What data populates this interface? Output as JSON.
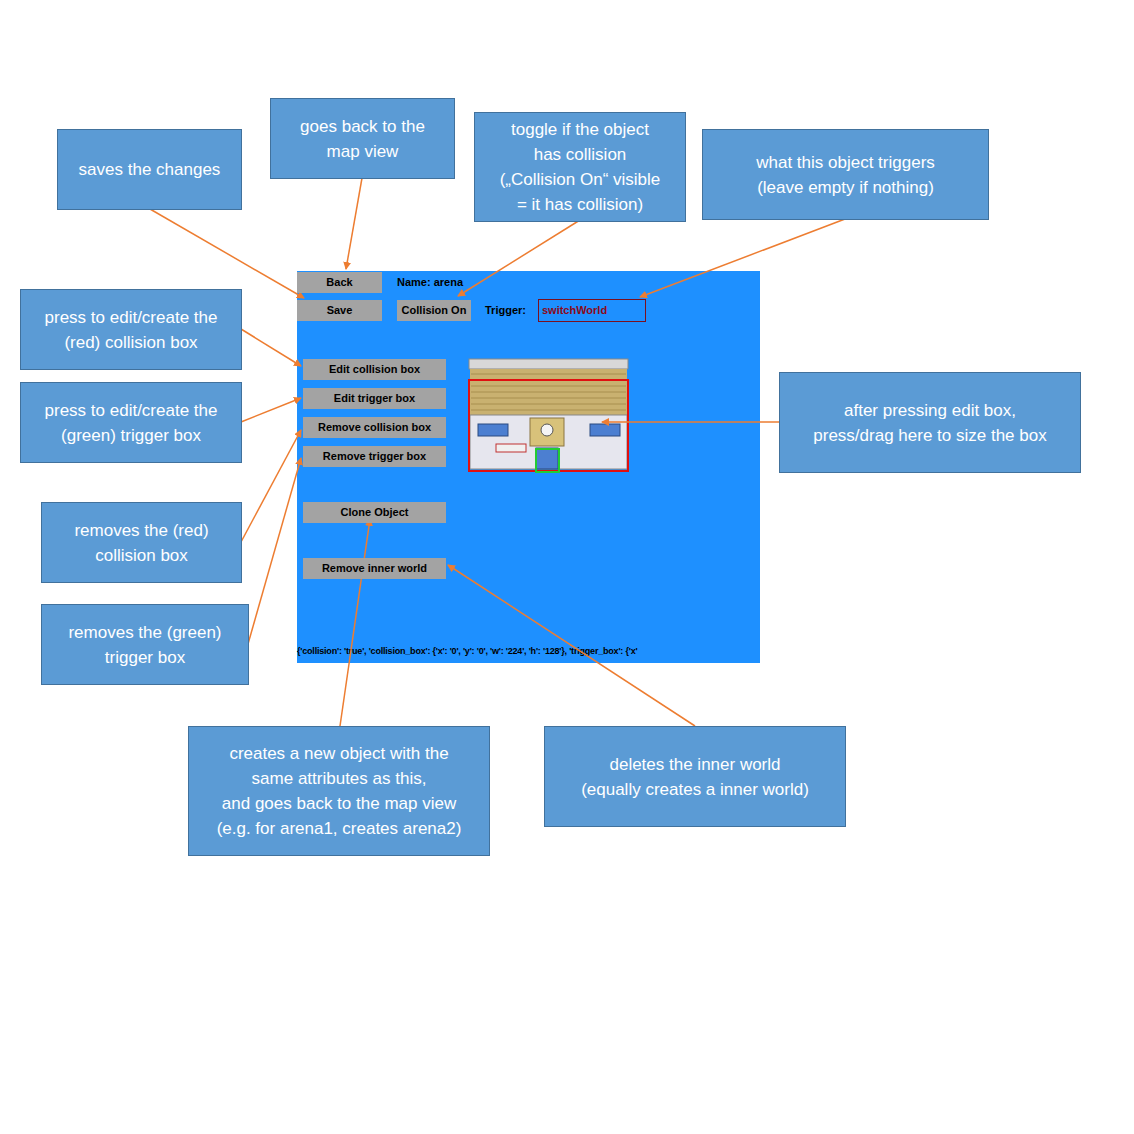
{
  "annotations": [
    {
      "lines": [
        "saves the changes"
      ]
    },
    {
      "lines": [
        "goes back to the",
        "map view"
      ]
    },
    {
      "lines": [
        "toggle if the object",
        "has collision",
        "(„Collision On“ visible",
        "= it has collision)"
      ]
    },
    {
      "lines": [
        "what this object triggers",
        "(leave empty if nothing)"
      ]
    },
    {
      "lines": [
        "press to edit/create the",
        "(red) collision box"
      ]
    },
    {
      "lines": [
        "press to edit/create the",
        "(green) trigger box"
      ]
    },
    {
      "lines": [
        "after pressing edit box,",
        "press/drag here to size the box"
      ]
    },
    {
      "lines": [
        "removes the (red)",
        "collision box"
      ]
    },
    {
      "lines": [
        "removes the (green)",
        "trigger box"
      ]
    },
    {
      "lines": [
        "creates a new object with the",
        "same attributes as this,",
        "and goes back to the map view",
        "(e.g. for arena1, creates arena2)"
      ]
    },
    {
      "lines": [
        "deletes the inner world",
        "(equally creates a inner world)"
      ]
    }
  ],
  "panel": {
    "back_button": "Back",
    "name_label": "Name: arena",
    "save_button": "Save",
    "collision_toggle": "Collision On",
    "trigger_label": "Trigger:",
    "trigger_value": "switchWorld",
    "box_buttons": [
      "Edit collision box",
      "Edit trigger box",
      "Remove collision box",
      "Remove trigger box"
    ],
    "clone_button": "Clone Object",
    "inner_world_button": "Remove inner world",
    "status_text": "{'collision': 'true', 'collision_box': {'x': '0', 'y': '0', 'w': '224', 'h': '128'}, 'trigger_box': {'x'"
  },
  "boxes": [
    {
      "kind": "collision",
      "color": "#e01010"
    },
    {
      "kind": "trigger",
      "color": "#22cc33"
    }
  ]
}
